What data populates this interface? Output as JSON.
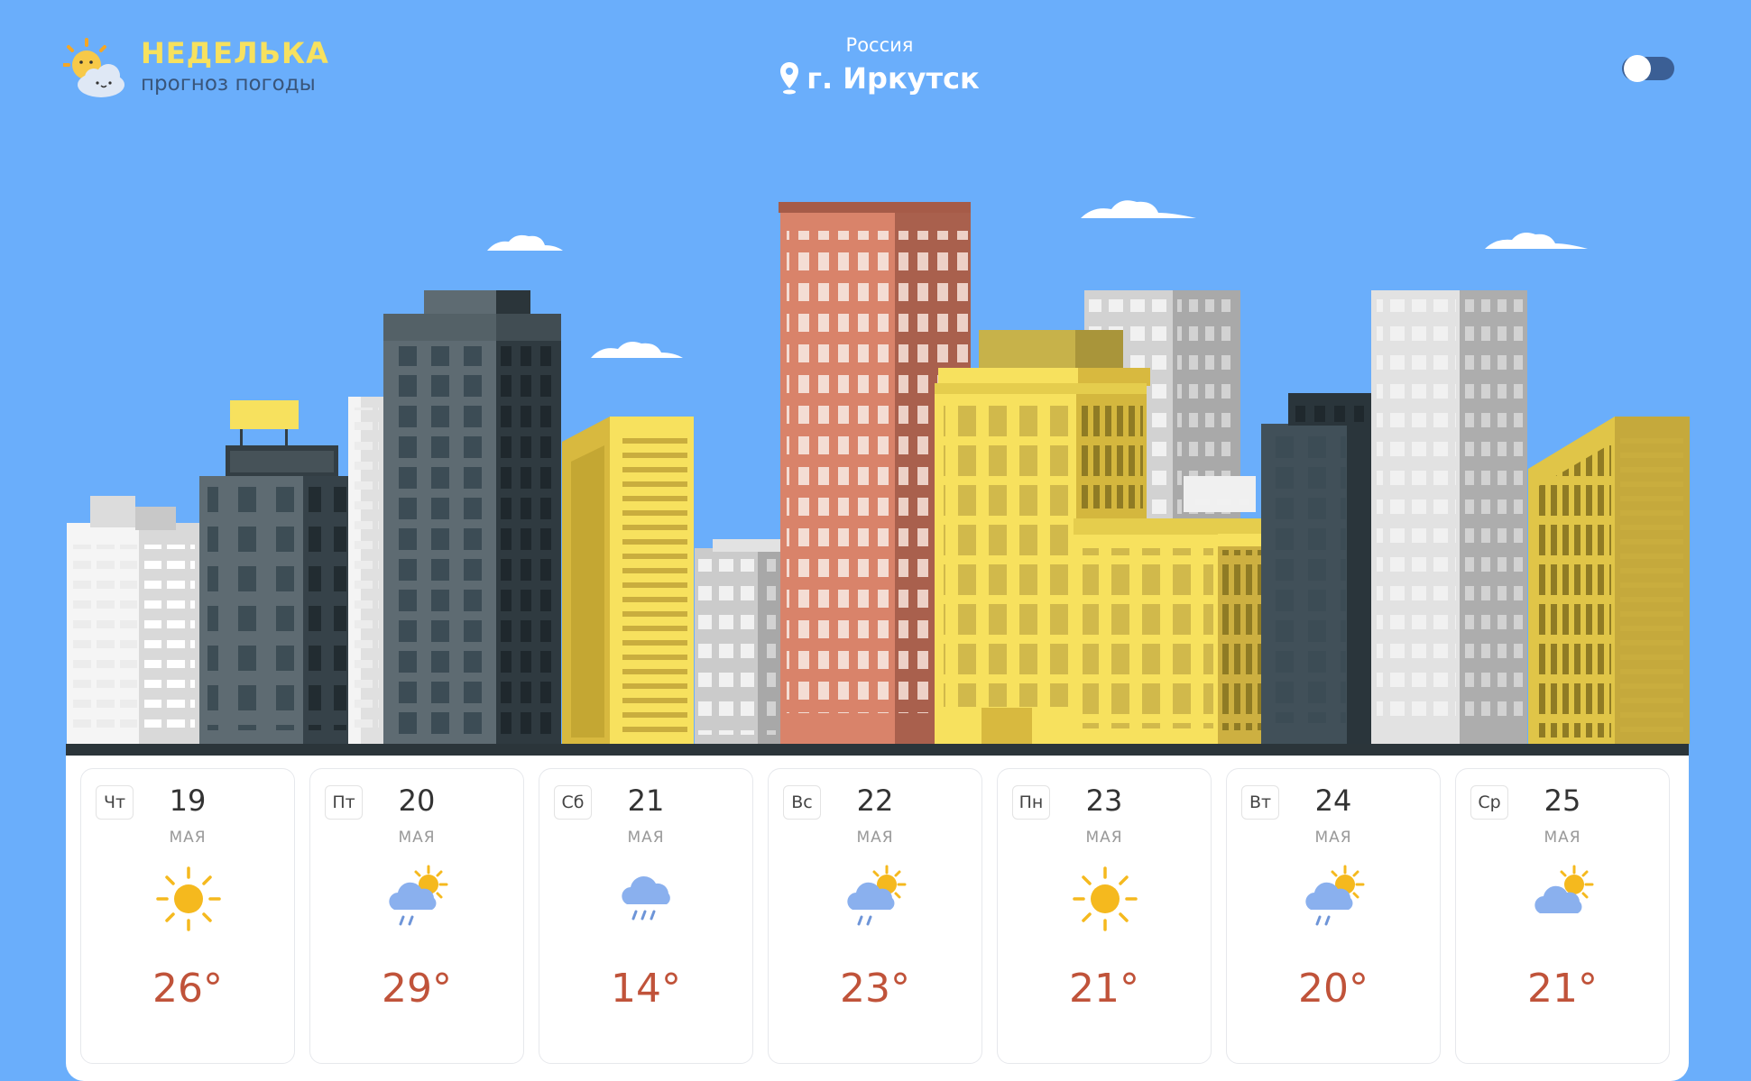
{
  "brand": {
    "title": "НЕДЕЛЬКА",
    "subtitle": "прогноз погоды"
  },
  "location": {
    "country": "Россия",
    "city": "г. Иркутск"
  },
  "theme_toggle": {
    "state": "off"
  },
  "colors": {
    "sky": "#6aaefb",
    "temperature": "#c0533a",
    "brand_yellow": "#f7e15e",
    "sun": "#f5b91e",
    "cloud": "#8ab0ee"
  },
  "forecast": [
    {
      "dow": "Чт",
      "day": "19",
      "month": "МАЯ",
      "temp": "26°",
      "icon": "sun"
    },
    {
      "dow": "Пт",
      "day": "20",
      "month": "МАЯ",
      "temp": "29°",
      "icon": "sun-cloud-rain"
    },
    {
      "dow": "Сб",
      "day": "21",
      "month": "МАЯ",
      "temp": "14°",
      "icon": "cloud-rain"
    },
    {
      "dow": "Вс",
      "day": "22",
      "month": "МАЯ",
      "temp": "23°",
      "icon": "sun-cloud-rain"
    },
    {
      "dow": "Пн",
      "day": "23",
      "month": "МАЯ",
      "temp": "21°",
      "icon": "sun"
    },
    {
      "dow": "Вт",
      "day": "24",
      "month": "МАЯ",
      "temp": "20°",
      "icon": "sun-cloud-rain"
    },
    {
      "dow": "Ср",
      "day": "25",
      "month": "МАЯ",
      "temp": "21°",
      "icon": "sun-cloud"
    }
  ]
}
